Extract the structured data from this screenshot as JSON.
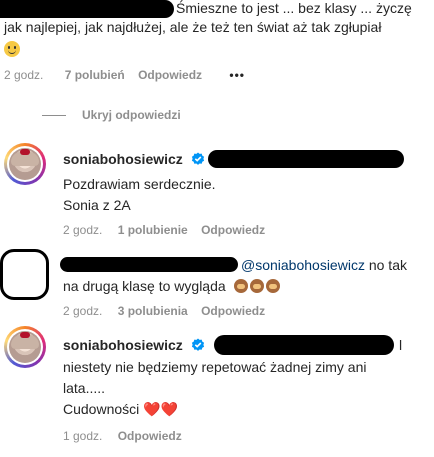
{
  "top_comment": {
    "text_line1": "Śmieszne to jest ... bez klasy ... życzę",
    "text_line2": "jak najlepiej, jak najdłużej, ale że też ten świat aż tak zgłupiał",
    "emoji": "🙂",
    "time": "2 godz.",
    "likes": "7 polubień",
    "reply": "Odpowiedz",
    "more": "•••"
  },
  "hide_replies": "Ukryj odpowiedzi",
  "replies": [
    {
      "username": "soniabohosiewicz",
      "line1": "Pozdrawiam serdecznie.",
      "line2": "Sonia z 2A",
      "time": "2 godz.",
      "likes": "1 polubienie",
      "reply": "Odpowiedz"
    },
    {
      "mention": "@soniabohosiewicz",
      "line1_rest": "no tak",
      "line2": "na drugą klasę to wygląda",
      "emojis": "🙈🙉🙊",
      "time": "2 godz.",
      "likes": "3 polubienia",
      "reply": "Odpowiedz"
    },
    {
      "username": "soniabohosiewicz",
      "line1_tail": "l",
      "line2": "niestety nie będziemy repetować żadnej zimy ani",
      "line3": "lata.....",
      "line4": "Cudowności ❤️❤️",
      "time": "1 godz.",
      "reply": "Odpowiedz"
    }
  ],
  "colors": {
    "text": "#262626",
    "meta": "#8e8e8e",
    "verified": "#0095f6",
    "redaction": "#000000"
  }
}
